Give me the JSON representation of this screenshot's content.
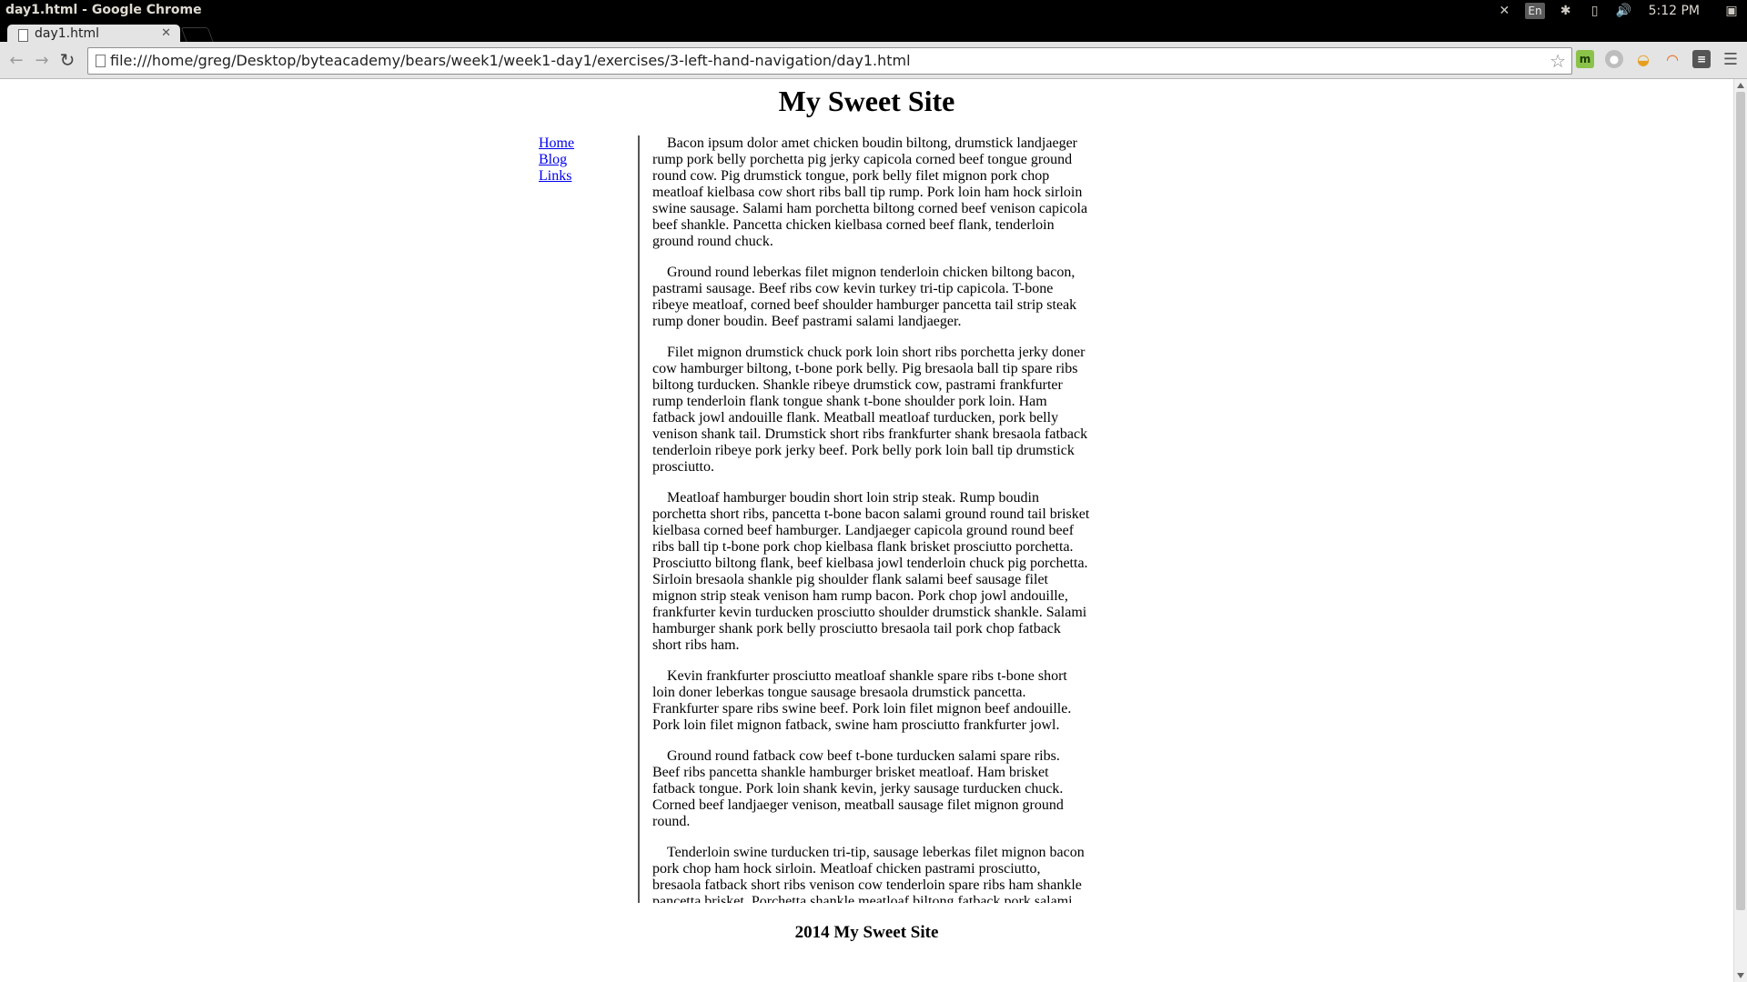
{
  "os": {
    "window_title": "day1.html - Google Chrome",
    "input_lang": "En",
    "clock": "5:12 PM"
  },
  "browser": {
    "tab_title": "day1.html",
    "url": "file:///home/greg/Desktop/byteacademy/bears/week1/week1-day1/exercises/3-left-hand-navigation/day1.html"
  },
  "page": {
    "title": "My Sweet Site",
    "nav": [
      "Home",
      "Blog",
      "Links"
    ],
    "paragraphs": [
      "Bacon ipsum dolor amet chicken boudin biltong, drumstick landjaeger rump pork belly porchetta pig jerky capicola corned beef tongue ground round cow. Pig drumstick tongue, pork belly filet mignon pork chop meatloaf kielbasa cow short ribs ball tip rump. Pork loin ham hock sirloin swine sausage. Salami ham porchetta biltong corned beef venison capicola beef shankle. Pancetta chicken kielbasa corned beef flank, tenderloin ground round chuck.",
      "Ground round leberkas filet mignon tenderloin chicken biltong bacon, pastrami sausage. Beef ribs cow kevin turkey tri-tip capicola. T-bone ribeye meatloaf, corned beef shoulder hamburger pancetta tail strip steak rump doner boudin. Beef pastrami salami landjaeger.",
      "Filet mignon drumstick chuck pork loin short ribs porchetta jerky doner cow hamburger biltong, t-bone pork belly. Pig bresaola ball tip spare ribs biltong turducken. Shankle ribeye drumstick cow, pastrami frankfurter rump tenderloin flank tongue shank t-bone shoulder pork loin. Ham fatback jowl andouille flank. Meatball meatloaf turducken, pork belly venison shank tail. Drumstick short ribs frankfurter shank bresaola fatback tenderloin ribeye pork jerky beef. Pork belly pork loin ball tip drumstick prosciutto.",
      "Meatloaf hamburger boudin short loin strip steak. Rump boudin porchetta short ribs, pancetta t-bone bacon salami ground round tail brisket kielbasa corned beef hamburger. Landjaeger capicola ground round beef ribs ball tip t-bone pork chop kielbasa flank brisket prosciutto porchetta. Prosciutto biltong flank, beef kielbasa jowl tenderloin chuck pig porchetta. Sirloin bresaola shankle pig shoulder flank salami beef sausage filet mignon strip steak venison ham rump bacon. Pork chop jowl andouille, frankfurter kevin turducken prosciutto shoulder drumstick shankle. Salami hamburger shank pork belly prosciutto bresaola tail pork chop fatback short ribs ham.",
      "Kevin frankfurter prosciutto meatloaf shankle spare ribs t-bone short loin doner leberkas tongue sausage bresaola drumstick pancetta. Frankfurter spare ribs swine beef. Pork loin filet mignon beef andouille. Pork loin filet mignon fatback, swine ham prosciutto frankfurter jowl.",
      "Ground round fatback cow beef t-bone turducken salami spare ribs. Beef ribs pancetta shankle hamburger brisket meatloaf. Ham brisket fatback tongue. Pork loin shank kevin, jerky sausage turducken chuck. Corned beef landjaeger venison, meatball sausage filet mignon ground round.",
      "Tenderloin swine turducken tri-tip, sausage leberkas filet mignon bacon pork chop ham hock sirloin. Meatloaf chicken pastrami prosciutto, bresaola fatback short ribs venison cow tenderloin spare ribs ham shankle pancetta brisket. Porchetta shankle meatloaf biltong fatback pork salami."
    ],
    "footer": "2014 My Sweet Site"
  },
  "icons": {
    "os_tray": [
      "pin-icon",
      "input-lang-icon",
      "bluetooth-icon",
      "battery-icon",
      "volume-icon",
      "clock",
      "system-icon"
    ],
    "extensions": [
      "m-extension-icon",
      "circle-extension-icon",
      "food-extension-icon",
      "rss-extension-icon",
      "incognito-extension-icon",
      "chrome-menu-icon"
    ]
  },
  "colors": {
    "link": "#0000ee",
    "os_panel": "#000000",
    "toolbar": "#e4e4e4"
  }
}
